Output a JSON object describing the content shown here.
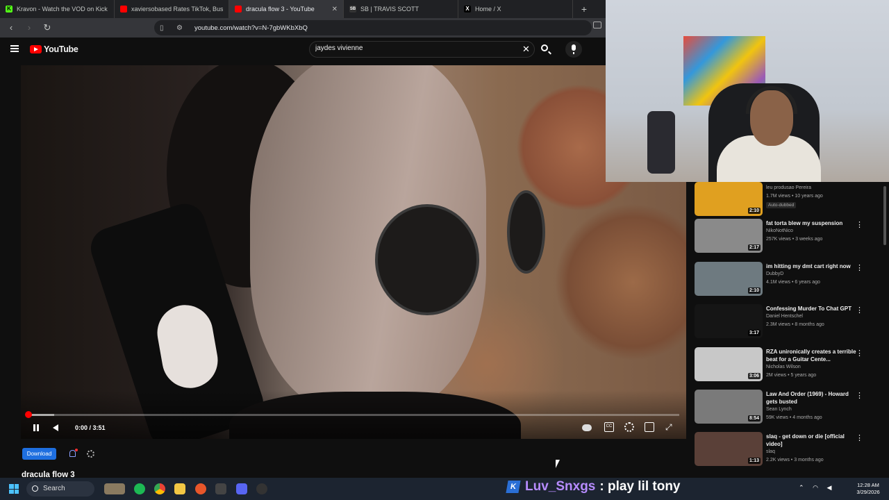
{
  "browser": {
    "tabs": [
      {
        "label": "Kravon - Watch the VOD on Kick",
        "icon": "kick-icon",
        "active": false
      },
      {
        "label": "xaviersobased Rates TikTok, Bushwick",
        "icon": "youtube-icon",
        "active": false
      },
      {
        "label": "dracula flow 3 - YouTube",
        "icon": "youtube-icon",
        "active": true
      },
      {
        "label": "SB | TRAVIS SCOTT",
        "icon": "sb-icon",
        "active": false
      },
      {
        "label": "Home / X",
        "icon": "x-icon",
        "active": false
      }
    ],
    "url": "youtube.com/watch?v=N-7gbWKbXbQ"
  },
  "youtube": {
    "logo_text": "YouTube",
    "search_value": "jaydes vivienne",
    "player": {
      "timecode": "0:00 / 3:51",
      "progress_fraction": 0.0,
      "buffered_fraction": 0.04
    },
    "download_label": "Download",
    "video_title": "dracula flow 3"
  },
  "recommendations": [
    {
      "title": "",
      "channel": "leu produsao Pereira",
      "meta": "1.7M views • 10 years ago",
      "badge": "Auto-dubbed",
      "duration": "2:10",
      "thumb_color": "#e0a020"
    },
    {
      "title": "fat torta blew my suspension",
      "channel": "NikoNotNico",
      "meta": "257K views • 3 weeks ago",
      "badge": "",
      "duration": "2:17",
      "thumb_color": "#8a8a8a"
    },
    {
      "title": "im hitting my dmt cart right now",
      "channel": "DubbyD",
      "meta": "4.1M views • 6 years ago",
      "badge": "",
      "duration": "2:10",
      "thumb_color": "#6e7a80"
    },
    {
      "title": "Confessing Murder To Chat GPT",
      "channel": "Daniel Hentschel",
      "meta": "2.3M views • 8 months ago",
      "badge": "",
      "duration": "3:17",
      "thumb_color": "#151515"
    },
    {
      "title": "RZA unironically creates a terrible beat for a Guitar Cente...",
      "channel": "Nicholas Wilson",
      "meta": "2M views • 5 years ago",
      "badge": "",
      "duration": "3:06",
      "thumb_color": "#c8c8c8"
    },
    {
      "title": "Law And Order (1969) - Howard gets busted",
      "channel": "Sean Lynch",
      "meta": "59K views • 4 months ago",
      "badge": "",
      "duration": "8:54",
      "thumb_color": "#7a7a7a"
    },
    {
      "title": "slaq - get down or die [official video]",
      "channel": "slaq",
      "meta": "2.2K views • 3 months ago",
      "badge": "",
      "duration": "1:13",
      "thumb_color": "#5a4038"
    }
  ],
  "taskbar": {
    "search_label": "Search",
    "time": "12:28 AM",
    "date": "3/29/2026"
  },
  "chat_overlay": {
    "username": "Luv_Snxgs",
    "message": ": play lil tony"
  },
  "colors": {
    "youtube_red": "#ff0000",
    "download_blue": "#1e6fe0",
    "chat_user": "#b78cff"
  }
}
